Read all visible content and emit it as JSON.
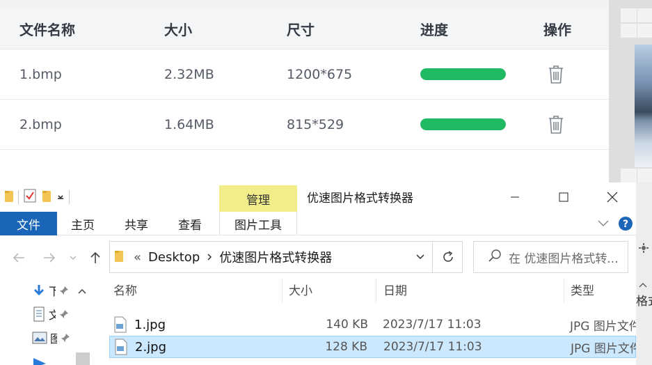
{
  "converter": {
    "headers": [
      "文件名称",
      "大小",
      "尺寸",
      "进度",
      "操作"
    ],
    "rows": [
      {
        "name": "1.bmp",
        "size": "2.32MB",
        "dimensions": "1200*675",
        "progress": 1.0
      },
      {
        "name": "2.bmp",
        "size": "1.64MB",
        "dimensions": "815*529",
        "progress": 1.0
      }
    ],
    "progress_color": "#1fba62"
  },
  "explorer": {
    "title": "优速图片格式转换器",
    "manage_tab": "管理",
    "ribbon_tabs": [
      "文件",
      "主页",
      "共享",
      "查看",
      "图片工具"
    ],
    "address": {
      "prefix": "«",
      "crumbs": [
        "Desktop",
        "优速图片格式转换器"
      ]
    },
    "search_placeholder": "在 优速图片格式转...",
    "columns": [
      "名称",
      "大小",
      "日期",
      "类型"
    ],
    "files": [
      {
        "name": "1.jpg",
        "size": "140 KB",
        "date": "2023/7/17 11:03",
        "type": "JPG 图片文件",
        "selected": false
      },
      {
        "name": "2.jpg",
        "size": "128 KB",
        "date": "2023/7/17 11:03",
        "type": "JPG 图片文件",
        "selected": true
      }
    ],
    "nav_items": [
      "下",
      "文",
      "图",
      ""
    ],
    "accent": "#1b65b8",
    "selection_color": "#cce8ff"
  },
  "right_panel": {
    "text": "格式"
  }
}
